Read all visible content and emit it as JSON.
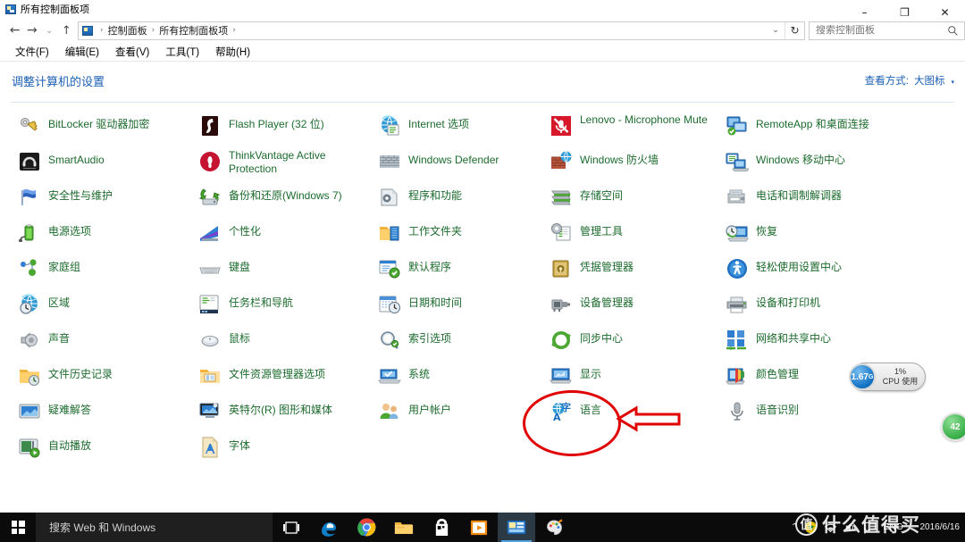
{
  "window": {
    "title": "所有控制面板项",
    "title_icon": "control-panel-icon",
    "minimize": "–",
    "maximize": "❐",
    "close": "✕"
  },
  "nav": {
    "back": "←",
    "forward": "→",
    "recent": "⌄",
    "up": "↑",
    "breadcrumbs": [
      "控制面板",
      "所有控制面板项"
    ],
    "separator": "›",
    "dropdown_caret": "⌄",
    "refresh": "↻"
  },
  "search": {
    "placeholder": "搜索控制面板",
    "value": "",
    "icon": "search-icon"
  },
  "menubar": {
    "items": [
      "文件(F)",
      "编辑(E)",
      "查看(V)",
      "工具(T)",
      "帮助(H)"
    ]
  },
  "content": {
    "page_title": "调整计算机的设置",
    "viewby_label": "查看方式:",
    "viewby_value": "大图标",
    "viewby_caret": "▾"
  },
  "items": [
    {
      "label": "BitLocker 驱动器加密",
      "icon": "bitlocker-icon",
      "col": 0,
      "row": 0
    },
    {
      "label": "SmartAudio",
      "icon": "smartaudio-icon",
      "col": 0,
      "row": 1
    },
    {
      "label": "安全性与维护",
      "icon": "security-flag-icon",
      "col": 0,
      "row": 2
    },
    {
      "label": "电源选项",
      "icon": "power-options-icon",
      "col": 0,
      "row": 3
    },
    {
      "label": "家庭组",
      "icon": "homegroup-icon",
      "col": 0,
      "row": 4
    },
    {
      "label": "区域",
      "icon": "region-clock-globe-icon",
      "col": 0,
      "row": 5
    },
    {
      "label": "声音",
      "icon": "sound-speaker-icon",
      "col": 0,
      "row": 6
    },
    {
      "label": "文件历史记录",
      "icon": "file-history-icon",
      "col": 0,
      "row": 7
    },
    {
      "label": "疑难解答",
      "icon": "troubleshoot-icon",
      "col": 0,
      "row": 8
    },
    {
      "label": "自动播放",
      "icon": "autoplay-icon",
      "col": 0,
      "row": 9
    },
    {
      "label": "Flash Player (32 位)",
      "icon": "flash-player-icon",
      "col": 1,
      "row": 0
    },
    {
      "label": "ThinkVantage Active Protection",
      "icon": "thinkvantage-icon",
      "col": 1,
      "row": 1,
      "two_line": true
    },
    {
      "label": "备份和还原(Windows 7)",
      "icon": "backup-restore-icon",
      "col": 1,
      "row": 2
    },
    {
      "label": "个性化",
      "icon": "personalization-icon",
      "col": 1,
      "row": 3
    },
    {
      "label": "键盘",
      "icon": "keyboard-icon",
      "col": 1,
      "row": 4
    },
    {
      "label": "任务栏和导航",
      "icon": "taskbar-navigation-icon",
      "col": 1,
      "row": 5
    },
    {
      "label": "鼠标",
      "icon": "mouse-icon",
      "col": 1,
      "row": 6
    },
    {
      "label": "文件资源管理器选项",
      "icon": "file-explorer-options-icon",
      "col": 1,
      "row": 7
    },
    {
      "label": "英特尔(R) 图形和媒体",
      "icon": "intel-graphics-icon",
      "col": 1,
      "row": 8
    },
    {
      "label": "字体",
      "icon": "fonts-icon",
      "col": 1,
      "row": 9
    },
    {
      "label": "Internet 选项",
      "icon": "internet-options-icon",
      "col": 2,
      "row": 0
    },
    {
      "label": "Windows Defender",
      "icon": "windows-defender-icon",
      "col": 2,
      "row": 1
    },
    {
      "label": "程序和功能",
      "icon": "programs-features-icon",
      "col": 2,
      "row": 2
    },
    {
      "label": "工作文件夹",
      "icon": "work-folders-icon",
      "col": 2,
      "row": 3
    },
    {
      "label": "默认程序",
      "icon": "default-programs-icon",
      "col": 2,
      "row": 4
    },
    {
      "label": "日期和时间",
      "icon": "date-time-icon",
      "col": 2,
      "row": 5
    },
    {
      "label": "索引选项",
      "icon": "indexing-options-icon",
      "col": 2,
      "row": 6
    },
    {
      "label": "系统",
      "icon": "system-icon",
      "col": 2,
      "row": 7
    },
    {
      "label": "用户帐户",
      "icon": "user-accounts-icon",
      "col": 2,
      "row": 8
    },
    {
      "label": "Lenovo - Microphone Mute",
      "icon": "lenovo-mic-mute-icon",
      "col": 3,
      "row": 0,
      "two_line": true
    },
    {
      "label": "Windows 防火墙",
      "icon": "windows-firewall-icon",
      "col": 3,
      "row": 1
    },
    {
      "label": "存储空间",
      "icon": "storage-spaces-icon",
      "col": 3,
      "row": 2
    },
    {
      "label": "管理工具",
      "icon": "admin-tools-icon",
      "col": 3,
      "row": 3
    },
    {
      "label": "凭据管理器",
      "icon": "credential-manager-icon",
      "col": 3,
      "row": 4
    },
    {
      "label": "设备管理器",
      "icon": "device-manager-icon",
      "col": 3,
      "row": 5
    },
    {
      "label": "同步中心",
      "icon": "sync-center-icon",
      "col": 3,
      "row": 6
    },
    {
      "label": "显示",
      "icon": "display-icon",
      "col": 3,
      "row": 7
    },
    {
      "label": "语言",
      "icon": "language-icon",
      "col": 3,
      "row": 8,
      "highlighted": true
    },
    {
      "label": "RemoteApp 和桌面连接",
      "icon": "remoteapp-icon",
      "col": 4,
      "row": 0
    },
    {
      "label": "Windows 移动中心",
      "icon": "mobility-center-icon",
      "col": 4,
      "row": 1
    },
    {
      "label": "电话和调制解调器",
      "icon": "phone-modem-icon",
      "col": 4,
      "row": 2
    },
    {
      "label": "恢复",
      "icon": "recovery-icon",
      "col": 4,
      "row": 3
    },
    {
      "label": "轻松使用设置中心",
      "icon": "ease-of-access-icon",
      "col": 4,
      "row": 4
    },
    {
      "label": "设备和打印机",
      "icon": "devices-printers-icon",
      "col": 4,
      "row": 5
    },
    {
      "label": "网络和共享中心",
      "icon": "network-sharing-icon",
      "col": 4,
      "row": 6
    },
    {
      "label": "颜色管理",
      "icon": "color-management-icon",
      "col": 4,
      "row": 7
    },
    {
      "label": "语音识别",
      "icon": "speech-recognition-icon",
      "col": 4,
      "row": 8
    }
  ],
  "annotation": {
    "shape": "red-ellipse",
    "color": "#e00000",
    "target_label": "语言",
    "arrow": "red-left-arrow"
  },
  "cpu_widget": {
    "memory": "1.67",
    "memory_unit": "G",
    "cpu_percent": "1%",
    "cpu_caption": "CPU 使用"
  },
  "temp_badge": {
    "value": "42"
  },
  "taskbar": {
    "start_icon": "windows-start-icon",
    "search_placeholder": "搜索 Web 和 Windows",
    "apps": [
      {
        "name": "task-view-icon"
      },
      {
        "name": "edge-icon"
      },
      {
        "name": "chrome-icon"
      },
      {
        "name": "file-explorer-icon"
      },
      {
        "name": "store-icon"
      },
      {
        "name": "movies-tv-icon"
      },
      {
        "name": "control-panel-icon",
        "active": true
      },
      {
        "name": "paint-icon"
      }
    ],
    "tray": {
      "chevron": "⌃",
      "icons": [
        "shield-update-icon",
        "network-wifi-icon",
        "volume-icon",
        "action-center-icon"
      ],
      "language": "ENG",
      "date": "2016/6/16"
    }
  },
  "watermark": {
    "badge": "值",
    "text": "什么值得买"
  }
}
